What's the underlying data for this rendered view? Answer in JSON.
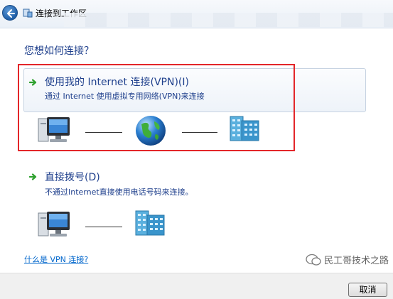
{
  "window": {
    "title": "连接到工作区"
  },
  "question": "您想如何连接？",
  "options": [
    {
      "title": "使用我的 Internet 连接(VPN)(I)",
      "description": "通过 Internet 使用虚拟专用网络(VPN)来连接"
    },
    {
      "title": "直接拨号(D)",
      "description": "不通过Internet直接使用电话号码来连接。"
    }
  ],
  "help_link": "什么是 VPN 连接?",
  "buttons": {
    "cancel": "取消"
  },
  "watermark": {
    "text": "民工哥技术之路"
  },
  "colors": {
    "heading": "#1e3f8c",
    "highlight_border": "#e3262a",
    "link": "#0066cc",
    "arrow": "#2ea12e"
  }
}
